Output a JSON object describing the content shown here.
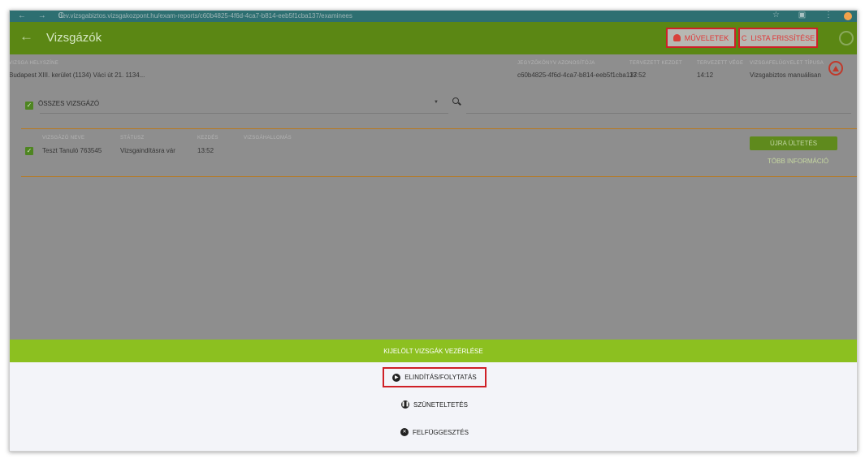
{
  "browser": {
    "nav_glyphs": "←  →  C",
    "url": "dev.vizsgabiztos.vizsgakozpont.hu/exam-reports/c60b4825-4f6d-4ca7-b814-eeb5f1cba137/examinees",
    "right_glyphs": "☆ ▣ ⋮"
  },
  "appbar": {
    "title": "Vizsgázók",
    "back_icon": "←",
    "operations_label": "MŰVELETEK",
    "refresh_label": "LISTA FRISSÍTÉSE",
    "refresh_icon": "C"
  },
  "exam_info": {
    "location_header": "VIZSGA HELYSZÍNE",
    "location_value": "Budapest XIII. kerület (1134) Váci út 21. 1134...",
    "log_id_header": "JEGYZŐKÖNYV AZONOSÍTÓJA",
    "log_id_value": "c60b4825-4f6d-4ca7-b814-eeb5f1cba137",
    "planned_start_header": "TERVEZETT KEZDET",
    "planned_start_value": "13:52",
    "planned_end_header": "TERVEZETT VÉGE",
    "planned_end_value": "14:12",
    "supervision_type_header": "VIZSGAFELÜGYELET TÍPUSA",
    "supervision_type_value": "Vizsgabiztos manuálisan"
  },
  "filter": {
    "select_all_label": "ÖSSZES VIZSGÁZÓ",
    "caret": "▼"
  },
  "examinee": {
    "name_header": "VIZSGÁZÓ NEVE",
    "status_header": "STÁTUSZ",
    "start_header": "KEZDÉS",
    "exam_terminal_header": "VIZSGÁHALLOMÁS",
    "name": "Teszt Tanuló 763545",
    "status": "Vizsgaindításra vár",
    "start": "13:52",
    "reseat_label": "ÚJRA ÜLTETÉS",
    "more_info_label": "TÖBB INFORMÁCIÓ"
  },
  "controls": {
    "banner_label": "KIJELÖLT VIZSGÁK VEZÉRLÉSE",
    "start_label": "ELINDÍTÁS/FOLYTATÁS",
    "start_icon": "▶",
    "pause_label": "SZÜNETELTETÉS",
    "pause_icon": "❚❚",
    "suspend_label": "FELFÜGGESZTÉS",
    "suspend_icon": "✕"
  },
  "colors": {
    "appbar": "#5b8714",
    "banner": "#8cc020",
    "highlight": "#cf2027"
  }
}
